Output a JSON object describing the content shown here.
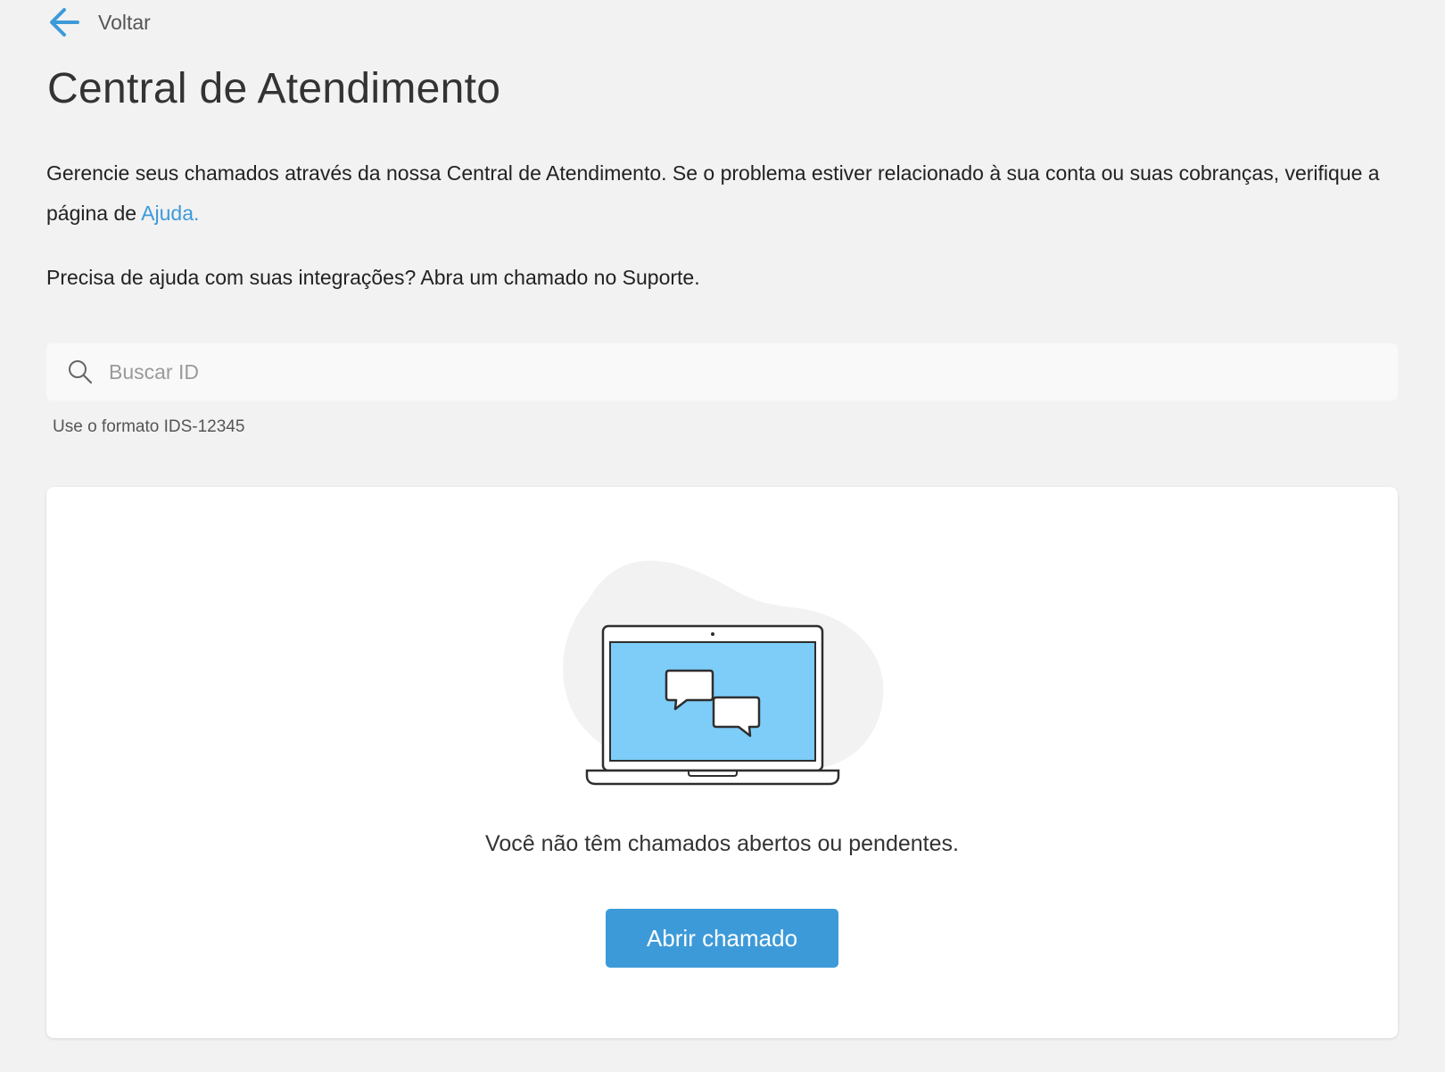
{
  "nav": {
    "back_label": "Voltar"
  },
  "page": {
    "title": "Central de Atendimento",
    "intro_text": "Gerencie seus chamados através da nossa Central de Atendimento. Se o problema estiver relacionado à sua conta ou suas cobranças, verifique a página de ",
    "help_link": "Ajuda.",
    "support_text": "Precisa de ajuda com suas integrações? Abra um chamado no Suporte."
  },
  "search": {
    "placeholder": "Buscar ID",
    "value": "",
    "hint": "Use o formato IDS-12345"
  },
  "empty_state": {
    "illustration": "laptop-chat-icon",
    "message": "Você não têm chamados abertos ou pendentes.",
    "button_label": "Abrir chamado"
  },
  "colors": {
    "accent": "#3d9ad9",
    "background": "#f2f2f2",
    "screen": "#7dcdf8"
  }
}
